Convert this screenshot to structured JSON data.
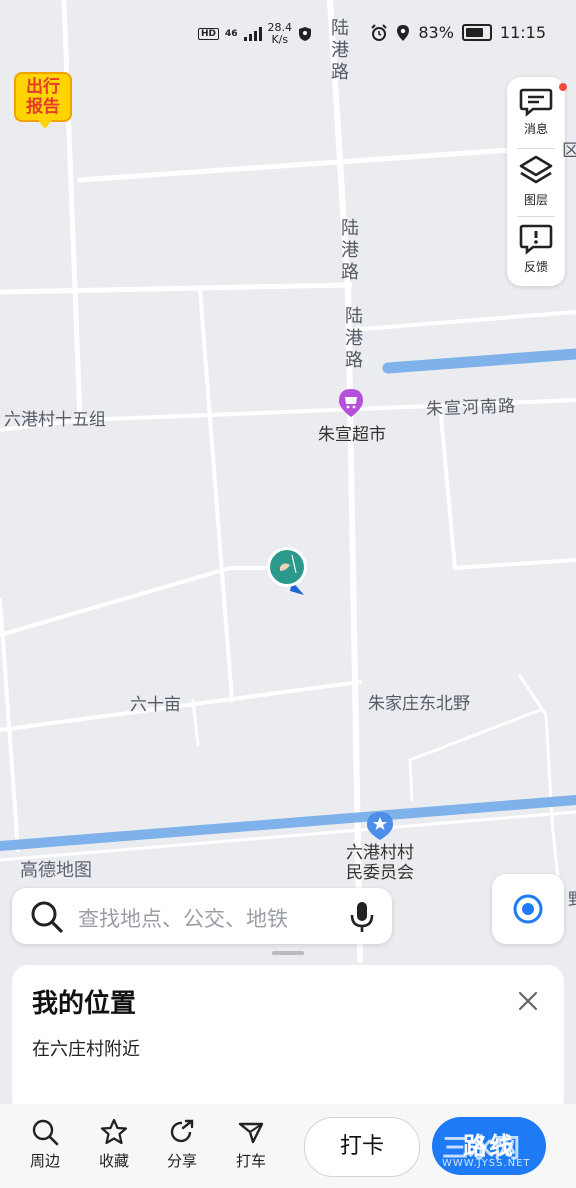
{
  "status_bar": {
    "hd": "HD",
    "signal": "46",
    "speed_value": "28.4",
    "speed_unit": "K/s",
    "battery": "83%",
    "time": "11:15"
  },
  "travel_badge": {
    "line1": "出行",
    "line2": "报告"
  },
  "right_panel": {
    "messages": "消息",
    "layers": "图层",
    "feedback": "反馈"
  },
  "map": {
    "labels": {
      "road_lugang_1": [
        "陆",
        "港",
        "路"
      ],
      "road_lugang_2": [
        "陆",
        "港",
        "路"
      ],
      "road_lugang_3": [
        "陆",
        "港",
        "路"
      ],
      "liugang_15": "六港村十五组",
      "zhuxuan_road": "朱宣河南路",
      "supermarket": "朱宣超市",
      "liushimu": "六十亩",
      "zhujiazhuang": "朱家庄东北野",
      "committee_line1": "六港村村",
      "committee_line2": "民委员会",
      "logo": "高德地图",
      "edge_right_top": "区",
      "edge_right_bottom": "野"
    }
  },
  "search": {
    "placeholder": "查找地点、公交、地铁"
  },
  "location_card": {
    "title": "我的位置",
    "subtitle": "在六庄村附近"
  },
  "bottom_tabs": [
    {
      "label": "周边",
      "icon": "search-icon"
    },
    {
      "label": "收藏",
      "icon": "star-icon"
    },
    {
      "label": "分享",
      "icon": "share-icon"
    },
    {
      "label": "打车",
      "icon": "taxi-icon"
    }
  ],
  "buttons": {
    "checkin": "打卡",
    "route": "路线"
  },
  "watermark": {
    "main": "三水网",
    "sub": "WWW.JYSS.NET"
  },
  "colors": {
    "accent": "#1e7bf5",
    "river": "#7fb2ea",
    "poi": "#b64fd9"
  }
}
